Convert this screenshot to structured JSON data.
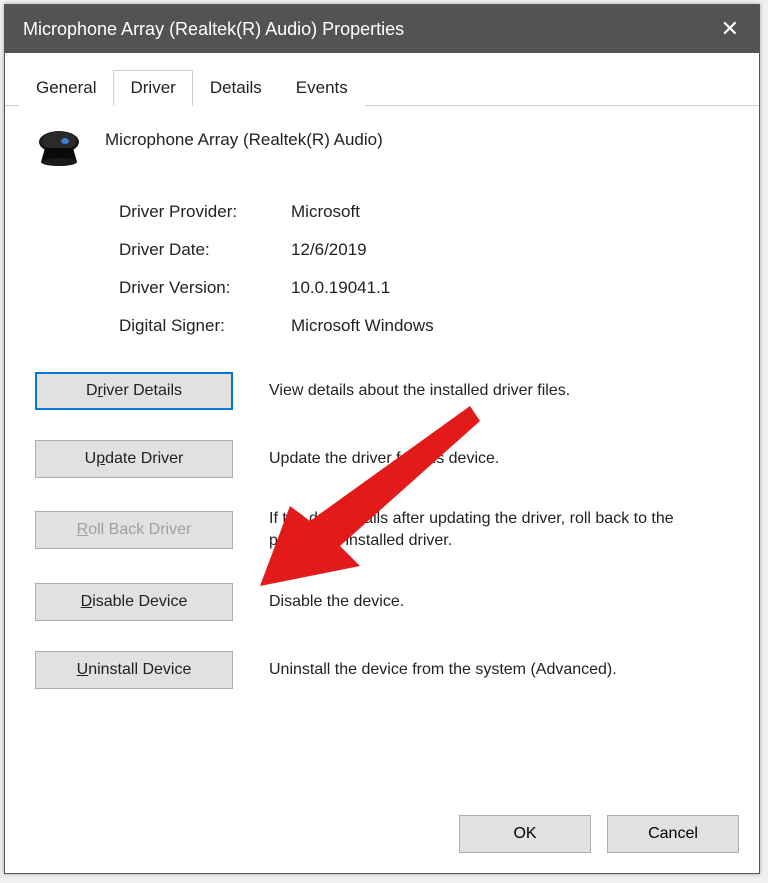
{
  "title": "Microphone Array (Realtek(R) Audio) Properties",
  "tabs": [
    {
      "label": "General"
    },
    {
      "label": "Driver"
    },
    {
      "label": "Details"
    },
    {
      "label": "Events"
    }
  ],
  "active_tab": "Driver",
  "device_name": "Microphone Array (Realtek(R) Audio)",
  "info": {
    "provider_label": "Driver Provider:",
    "provider_value": "Microsoft",
    "date_label": "Driver Date:",
    "date_value": "12/6/2019",
    "version_label": "Driver Version:",
    "version_value": "10.0.19041.1",
    "signer_label": "Digital Signer:",
    "signer_value": "Microsoft Windows"
  },
  "actions": {
    "details_label": "Driver Details",
    "details_desc": "View details about the installed driver files.",
    "update_label": "Update Driver",
    "update_desc": "Update the driver for this device.",
    "rollback_label": "Roll Back Driver",
    "rollback_desc": "If the device fails after updating the driver, roll back to the previously installed driver.",
    "disable_label": "Disable Device",
    "disable_desc": "Disable the device.",
    "uninstall_label": "Uninstall Device",
    "uninstall_desc": "Uninstall the device from the system (Advanced)."
  },
  "footer": {
    "ok_label": "OK",
    "cancel_label": "Cancel"
  }
}
